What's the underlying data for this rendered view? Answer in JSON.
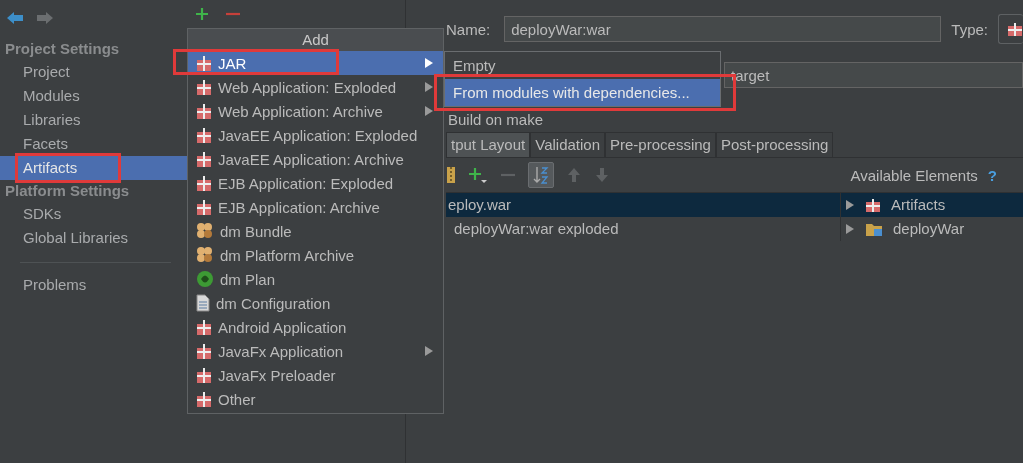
{
  "sidebar": {
    "sections": [
      {
        "title": "Project Settings",
        "items": [
          {
            "label": "Project",
            "selected": false,
            "highlighted": false
          },
          {
            "label": "Modules",
            "selected": false,
            "highlighted": false
          },
          {
            "label": "Libraries",
            "selected": false,
            "highlighted": false
          },
          {
            "label": "Facets",
            "selected": false,
            "highlighted": false
          },
          {
            "label": "Artifacts",
            "selected": true,
            "highlighted": true
          }
        ]
      },
      {
        "title": "Platform Settings",
        "items": [
          {
            "label": "SDKs",
            "selected": false,
            "highlighted": false
          },
          {
            "label": "Global Libraries",
            "selected": false,
            "highlighted": false
          }
        ]
      },
      {
        "items": [
          {
            "label": "Problems",
            "selected": false,
            "highlighted": false
          }
        ]
      }
    ]
  },
  "add_menu": {
    "title": "Add",
    "items": [
      {
        "label": "JAR",
        "kind": "gift",
        "submenu": true,
        "selected": true,
        "highlighted": true
      },
      {
        "label": "Web Application: Exploded",
        "kind": "gift",
        "submenu": true,
        "selected": false,
        "highlighted": false
      },
      {
        "label": "Web Application: Archive",
        "kind": "gift",
        "submenu": true,
        "selected": false,
        "highlighted": false
      },
      {
        "label": "JavaEE Application: Exploded",
        "kind": "gift",
        "submenu": false,
        "selected": false,
        "highlighted": false
      },
      {
        "label": "JavaEE Application: Archive",
        "kind": "gift",
        "submenu": false,
        "selected": false,
        "highlighted": false
      },
      {
        "label": "EJB Application: Exploded",
        "kind": "gift",
        "submenu": false,
        "selected": false,
        "highlighted": false
      },
      {
        "label": "EJB Application: Archive",
        "kind": "gift",
        "submenu": false,
        "selected": false,
        "highlighted": false
      },
      {
        "label": "dm Bundle",
        "kind": "bundle",
        "submenu": false,
        "selected": false,
        "highlighted": false
      },
      {
        "label": "dm Platform Archive",
        "kind": "bundle",
        "submenu": false,
        "selected": false,
        "highlighted": false
      },
      {
        "label": "dm Plan",
        "kind": "globe",
        "submenu": false,
        "selected": false,
        "highlighted": false
      },
      {
        "label": "dm Configuration",
        "kind": "document",
        "submenu": false,
        "selected": false,
        "highlighted": false
      },
      {
        "label": "Android Application",
        "kind": "gift",
        "submenu": false,
        "selected": false,
        "highlighted": false
      },
      {
        "label": "JavaFx Application",
        "kind": "gift",
        "submenu": true,
        "selected": false,
        "highlighted": false
      },
      {
        "label": "JavaFx Preloader",
        "kind": "gift",
        "submenu": false,
        "selected": false,
        "highlighted": false
      },
      {
        "label": "Other",
        "kind": "gift",
        "submenu": false,
        "selected": false,
        "highlighted": false
      }
    ]
  },
  "jar_submenu": {
    "items": [
      {
        "label": "Empty",
        "selected": false,
        "highlighted": false
      },
      {
        "label": "From modules with dependencies...",
        "selected": true,
        "highlighted": true
      }
    ]
  },
  "artifact": {
    "name_label": "Name:",
    "name_value": "deployWar:war",
    "type_label": "Type:",
    "output_directory": "target",
    "build_on_make": "Build on make"
  },
  "tabs": [
    {
      "label": "tput Layout",
      "selected": true
    },
    {
      "label": "Validation",
      "selected": false
    },
    {
      "label": "Pre-processing",
      "selected": false
    },
    {
      "label": "Post-processing",
      "selected": false
    }
  ],
  "available_elements": {
    "title": "Available Elements",
    "help": "?"
  },
  "layout_tree": [
    {
      "label": "eploy.war",
      "selected": true
    },
    {
      "label": "deployWar:war exploded",
      "selected": false
    }
  ],
  "elements_tree": [
    {
      "label": "Artifacts",
      "kind": "gift",
      "selected": true
    },
    {
      "label": "deployWar",
      "kind": "folder",
      "selected": false
    }
  ]
}
